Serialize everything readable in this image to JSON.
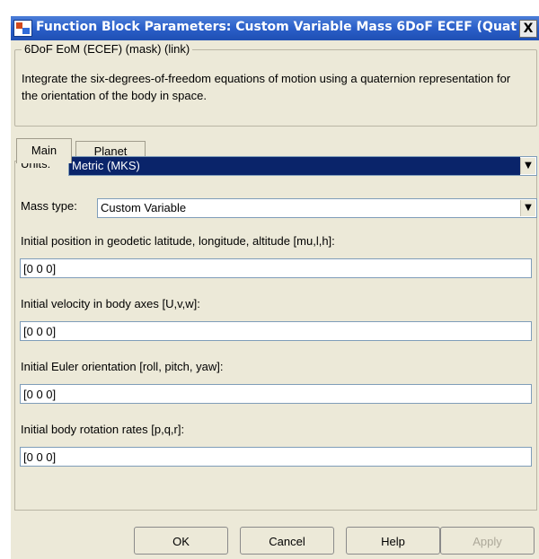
{
  "window": {
    "title": "Function Block Parameters: Custom Variable Mass 6DoF ECEF (Quat...",
    "close_label": "X"
  },
  "mask": {
    "group_label": "6DoF EoM (ECEF) (mask) (link)",
    "description": "Integrate the six-degrees-of-freedom equations of motion using a quaternion representation for the orientation of the body in space."
  },
  "tabs": [
    {
      "label": "Main",
      "selected": true
    },
    {
      "label": "Planet",
      "selected": false
    }
  ],
  "units": {
    "label": "Units:",
    "value": "Metric (MKS)"
  },
  "mass_type": {
    "label": "Mass type:",
    "value": "Custom Variable"
  },
  "initial_position": {
    "label": "Initial position in geodetic latitude, longitude, altitude [mu,l,h]:",
    "value": "[0 0 0]"
  },
  "initial_velocity": {
    "label": "Initial velocity in body axes [U,v,w]:",
    "value": "[0 0 0]"
  },
  "initial_euler": {
    "label": "Initial Euler orientation [roll, pitch, yaw]:",
    "value": "[0 0 0]"
  },
  "initial_rates": {
    "label": "Initial body rotation rates [p,q,r]:",
    "value": "[0 0 0]"
  },
  "buttons": {
    "ok": "OK",
    "cancel": "Cancel",
    "help": "Help",
    "apply": "Apply"
  }
}
